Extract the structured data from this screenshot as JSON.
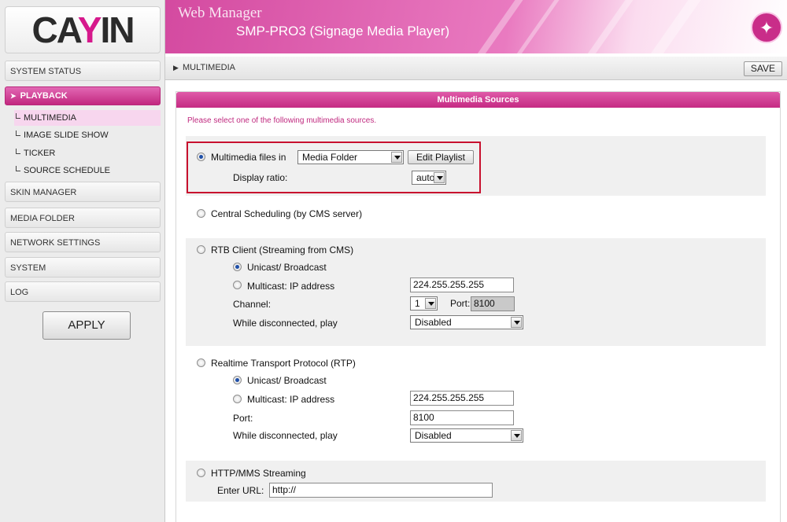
{
  "header": {
    "title": "Web Manager",
    "subtitle": "SMP-PRO3 (Signage Media Player)"
  },
  "logo": {
    "text": "CAYIN"
  },
  "sidebar": {
    "items": [
      {
        "label": "SYSTEM STATUS"
      },
      {
        "label": "PLAYBACK"
      },
      {
        "label": "SKIN MANAGER"
      },
      {
        "label": "MEDIA FOLDER"
      },
      {
        "label": "NETWORK SETTINGS"
      },
      {
        "label": "SYSTEM"
      },
      {
        "label": "LOG"
      }
    ],
    "subitems": [
      {
        "label": "MULTIMEDIA"
      },
      {
        "label": "IMAGE SLIDE SHOW"
      },
      {
        "label": "TICKER"
      },
      {
        "label": "SOURCE SCHEDULE"
      }
    ],
    "apply_label": "APPLY"
  },
  "breadcrumb": {
    "label": "MULTIMEDIA"
  },
  "toolbar": {
    "save_label": "SAVE"
  },
  "panel": {
    "title": "Multimedia Sources",
    "instruction": "Please select one of the following multimedia sources."
  },
  "multimedia_files": {
    "label": "Multimedia files in",
    "folder_value": "Media Folder",
    "edit_playlist_label": "Edit Playlist",
    "display_ratio_label": "Display ratio:",
    "display_ratio_value": "auto"
  },
  "central_scheduling": {
    "label": "Central Scheduling (by CMS server)"
  },
  "rtb_client": {
    "label": "RTB Client (Streaming from CMS)",
    "unicast_label": "Unicast/ Broadcast",
    "multicast_label": "Multicast: IP address",
    "ip_value": "224.255.255.255",
    "channel_label": "Channel:",
    "channel_value": "1",
    "port_label": "Port:",
    "port_value": "8100",
    "disconnected_label": "While disconnected, play",
    "disconnected_value": "Disabled"
  },
  "rtp": {
    "label": "Realtime Transport Protocol (RTP)",
    "unicast_label": "Unicast/ Broadcast",
    "multicast_label": "Multicast: IP address",
    "ip_value": "224.255.255.255",
    "port_label": "Port:",
    "port_value": "8100",
    "disconnected_label": "While disconnected, play",
    "disconnected_value": "Disabled"
  },
  "http_mms": {
    "label": "HTTP/MMS Streaming",
    "url_label": "Enter URL:",
    "url_value": "http://"
  },
  "colors": {
    "accent": "#c52a83",
    "highlight": "#c8102e"
  }
}
